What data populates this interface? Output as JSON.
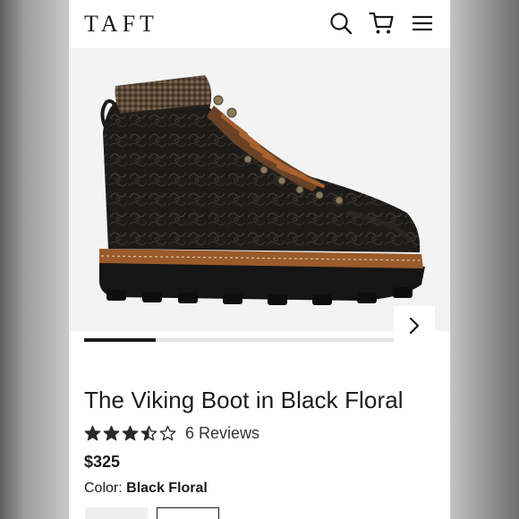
{
  "header": {
    "logo": "TAFT",
    "icons": [
      "search-icon",
      "cart-icon",
      "menu-icon"
    ]
  },
  "gallery": {
    "image": "black-floral-hiking-boot",
    "progress": 0.23
  },
  "product": {
    "title": "The Viking Boot in Black Floral",
    "rating": 3.5,
    "rating_max": 5,
    "reviews_label": "6 Reviews",
    "price": "$325",
    "color_label": "Color:",
    "color_value": "Black Floral"
  },
  "colors": {
    "star": "#2a2a2a",
    "text": "#1a1a1a",
    "progress_fill": "#1a1a1a",
    "progress_track": "#e4e4e8"
  }
}
